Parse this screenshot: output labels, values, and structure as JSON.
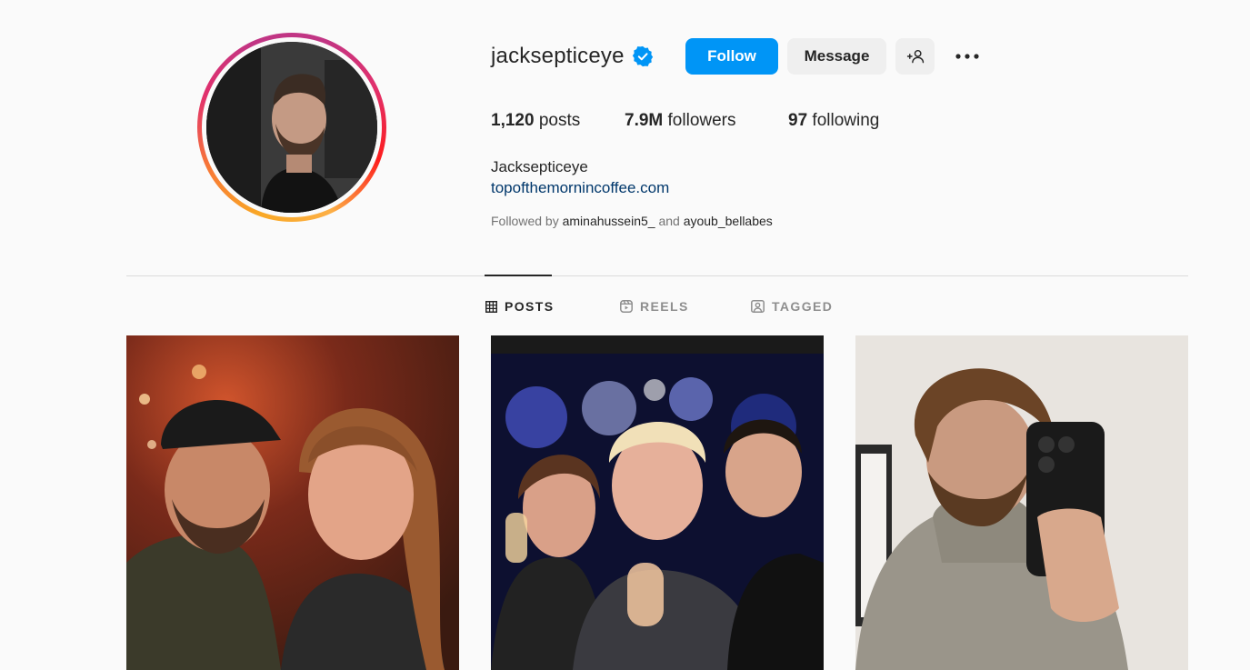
{
  "profile": {
    "username": "jacksepticeye",
    "verified": true,
    "full_name": "Jacksepticeye",
    "link": "topofthemornincoffee.com",
    "followed_by_prefix": "Followed by",
    "followed_by_1": "aminahussein5_",
    "followed_by_and": "and",
    "followed_by_2": "ayoub_bellabes"
  },
  "actions": {
    "follow_label": "Follow",
    "message_label": "Message",
    "add_user_icon": "add-person-icon",
    "more_icon": "ellipsis-icon"
  },
  "stats": {
    "posts_count": "1,120",
    "posts_label": "posts",
    "followers_count": "7.9M",
    "followers_label": "followers",
    "following_count": "97",
    "following_label": "following"
  },
  "tabs": [
    {
      "label": "POSTS",
      "icon": "grid-icon",
      "active": true
    },
    {
      "label": "REELS",
      "icon": "reels-icon",
      "active": false
    },
    {
      "label": "TAGGED",
      "icon": "tagged-icon",
      "active": false
    }
  ],
  "colors": {
    "accent": "#0095f6",
    "link": "#00376b",
    "background": "#fafafa",
    "secondary_button": "#efefef"
  }
}
